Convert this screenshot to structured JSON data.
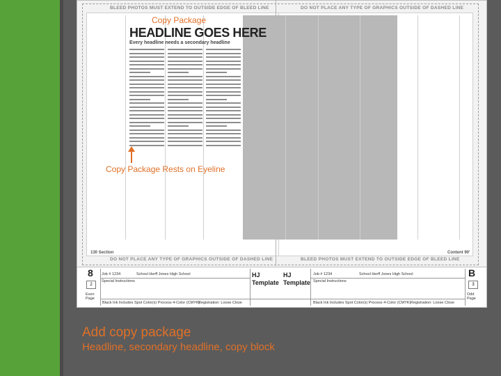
{
  "slide": {
    "caption_title": "Add copy package",
    "caption_subtitle": "Headline, secondary headline, copy block",
    "accent_color": "#e07028",
    "sidebar_color": "#57a339"
  },
  "template": {
    "warning_left": "BLEED PHOTOS MUST EXTEND TO OUTSIDE EDGE OF BLEED LINE",
    "warning_right": "DO NOT PLACE ANY TYPE OF GRAPHICS OUTSIDE OF DASHED LINE",
    "warning_bottom_left": "DO NOT PLACE ANY TYPE OF GRAPHICS OUTSIDE OF DASHED LINE",
    "warning_bottom_right": "BLEED PHOTOS MUST EXTEND TO OUTSIDE EDGE OF BLEED LINE",
    "copy_package_label": "Copy Package",
    "headline": "HEADLINE GOES HERE",
    "secondary_headline": "Every headline needs a secondary headline",
    "eyeline_label": "Copy Package Rests on Eyeline",
    "footer_left": "130 Section",
    "footer_right": "Content 90'"
  },
  "form": {
    "left_letter": "8",
    "right_letter": "B",
    "left_job": "Job # 1234",
    "left_school": "School Herff Jones High School",
    "left_instructions": "Special Instructions",
    "left_page_number": "2",
    "left_page_label": "Even Page",
    "right_job": "Job # 1234",
    "right_school": "School Herff Jones High School",
    "right_instructions": "Special Instructions",
    "right_page_number": "3",
    "right_page_label": "Odd Page",
    "template_left": "HJ Template",
    "template_right": "HJ Template",
    "options": "Black Ink  Includes Spot Color(s)  Process 4-Color (CMYK)",
    "registration": "Registration:  Loose  Close"
  }
}
